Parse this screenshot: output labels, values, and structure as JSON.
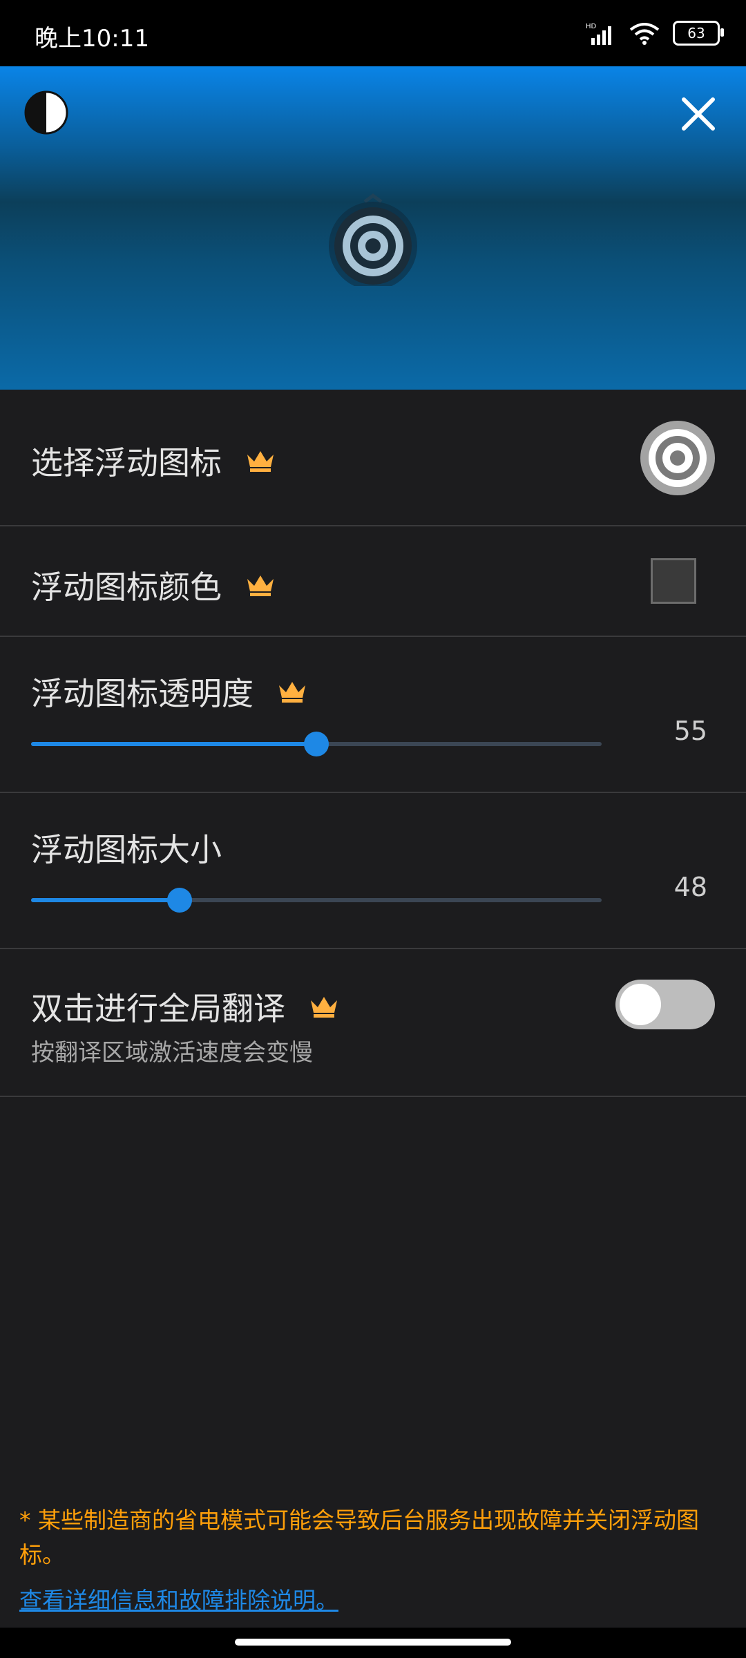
{
  "status": {
    "time": "晚上10:11",
    "battery": "63"
  },
  "header": {
    "contrast_icon": "contrast-icon",
    "close_icon": "close-icon"
  },
  "settings": {
    "icon_choice_label": "选择浮动图标",
    "color_label": "浮动图标颜色",
    "opacity_label": "浮动图标透明度",
    "opacity_value": "55",
    "size_label": "浮动图标大小",
    "size_value": "48",
    "double_tap_label": "双击进行全局翻译",
    "double_tap_sub": "按翻译区域激活速度会变慢",
    "double_tap_enabled": false
  },
  "sliders": {
    "opacity_fraction": 0.5,
    "size_fraction": 0.26
  },
  "footer": {
    "note": "* 某些制造商的省电模式可能会导致后台服务出现故障并关闭浮动图标。",
    "link": "查看详细信息和故障排除说明。"
  },
  "colors": {
    "accent": "#1e88e5",
    "premium": "#ffb040",
    "warning": "#ff9f0a",
    "background": "#1c1c1e"
  }
}
